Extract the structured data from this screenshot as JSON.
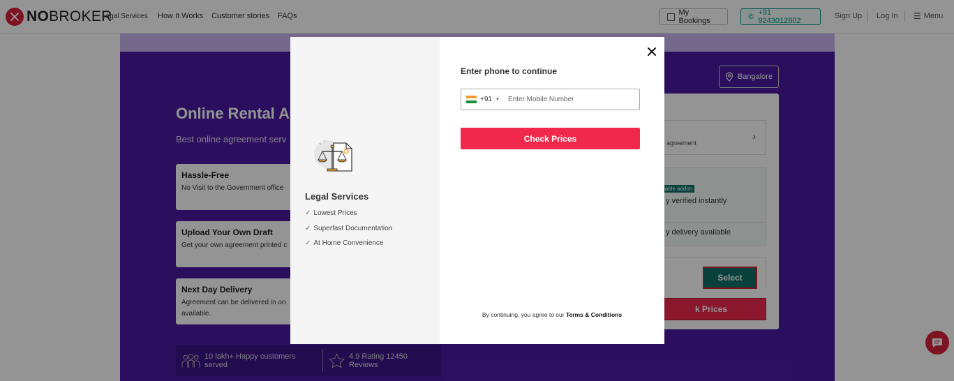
{
  "header": {
    "brand_prefix": "NO",
    "brand_suffix": "BROKER",
    "brand_sub": "Legal Services",
    "nav": [
      "How It Works",
      "Customer stories",
      "FAQs"
    ],
    "my_bookings": "My Bookings",
    "phone": "+91 9243012802",
    "sign_up": "Sign Up",
    "log_in": "Log In",
    "menu": "Menu"
  },
  "hero": {
    "city": "Bangalore",
    "title": "Online Rental Ag",
    "subtitle": "Best online agreement serv",
    "features": [
      {
        "title": "Hassle-Free",
        "desc": "No Visit to the Government office"
      },
      {
        "title": "Upload Your Own Draft",
        "desc": "Get your own agreement printed c"
      },
      {
        "title": "Next Day Delivery",
        "desc": "Agreement can be delivered in on",
        "desc2": "available."
      }
    ],
    "stats": [
      "10 lakh+ Happy customers served",
      "4.9 Rating 12450 Reviews"
    ]
  },
  "card": {
    "row1_text": "agreement",
    "addon_tag": "lable addon",
    "verified_text": "y verified instantly",
    "delivery_text": "y delivery available",
    "select_label": "Select",
    "cta_label": "k Prices"
  },
  "modal": {
    "left_title": "Legal Services",
    "benefits": [
      "Lowest Prices",
      "Superfast Documentation",
      "At Home Convenience"
    ],
    "title": "Enter phone to continue",
    "country_code": "+91",
    "phone_placeholder": "Enter Mobile Number",
    "phone_value": "",
    "submit_label": "Check Prices",
    "terms_prefix": "By continuing, you agree to our ",
    "terms_link": "Terms & Conditions"
  },
  "colors": {
    "brand_red": "#d8223a",
    "cta_red": "#f0294c",
    "hero_purple": "#4b1aa3",
    "teal": "#009587"
  }
}
